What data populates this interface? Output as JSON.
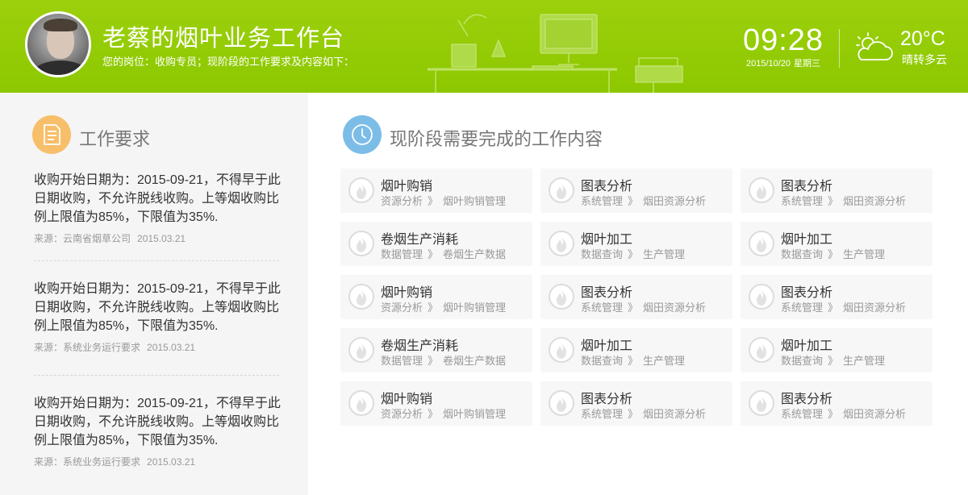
{
  "header": {
    "title": "老蔡的烟叶业务工作台",
    "subtitle": "您的岗位：收购专员；现阶段的工作要求及内容如下：",
    "time": "09:28",
    "date": "2015/10/20",
    "weekday": "星期三",
    "temperature": "20°C",
    "weather": "晴转多云",
    "weather_icon": "partly-cloudy-icon"
  },
  "requirements": {
    "title": "工作要求",
    "icon": "document-icon",
    "items": [
      {
        "text": "收购开始日期为：2015-09-21，不得早于此日期收购，不允许脱线收购。上等烟收购比例上限值为85%，下限值为35%.",
        "source_label": "来源：云南省烟草公司",
        "date": "2015.03.21"
      },
      {
        "text": "收购开始日期为：2015-09-21，不得早于此日期收购，不允许脱线收购。上等烟收购比例上限值为85%，下限值为35%.",
        "source_label": "来源：系统业务运行要求",
        "date": "2015.03.21"
      },
      {
        "text": "收购开始日期为：2015-09-21，不得早于此日期收购，不允许脱线收购。上等烟收购比例上限值为85%，下限值为35%.",
        "source_label": "来源：系统业务运行要求",
        "date": "2015.03.21"
      }
    ]
  },
  "tasks": {
    "title": "现阶段需要完成的工作内容",
    "icon": "clock-icon",
    "separator": "》",
    "cards": [
      {
        "title": "烟叶购销",
        "path": [
          "资源分析",
          "烟叶购销管理"
        ]
      },
      {
        "title": "图表分析",
        "path": [
          "系统管理",
          "烟田资源分析"
        ]
      },
      {
        "title": "图表分析",
        "path": [
          "系统管理",
          "烟田资源分析"
        ]
      },
      {
        "title": "卷烟生产消耗",
        "path": [
          "数据管理",
          "卷烟生产数据"
        ]
      },
      {
        "title": "烟叶加工",
        "path": [
          "数据查询",
          "生产管理"
        ]
      },
      {
        "title": "烟叶加工",
        "path": [
          "数据查询",
          "生产管理"
        ]
      },
      {
        "title": "烟叶购销",
        "path": [
          "资源分析",
          "烟叶购销管理"
        ]
      },
      {
        "title": "图表分析",
        "path": [
          "系统管理",
          "烟田资源分析"
        ]
      },
      {
        "title": "图表分析",
        "path": [
          "系统管理",
          "烟田资源分析"
        ]
      },
      {
        "title": "卷烟生产消耗",
        "path": [
          "数据管理",
          "卷烟生产数据"
        ]
      },
      {
        "title": "烟叶加工",
        "path": [
          "数据查询",
          "生产管理"
        ]
      },
      {
        "title": "烟叶加工",
        "path": [
          "数据查询",
          "生产管理"
        ]
      },
      {
        "title": "烟叶购销",
        "path": [
          "资源分析",
          "烟叶购销管理"
        ]
      },
      {
        "title": "图表分析",
        "path": [
          "系统管理",
          "烟田资源分析"
        ]
      },
      {
        "title": "图表分析",
        "path": [
          "系统管理",
          "烟田资源分析"
        ]
      }
    ]
  },
  "colors": {
    "header_green": "#8cc800",
    "doc_icon_orange": "#f7bf6a",
    "clock_icon_blue": "#7cbde8"
  }
}
